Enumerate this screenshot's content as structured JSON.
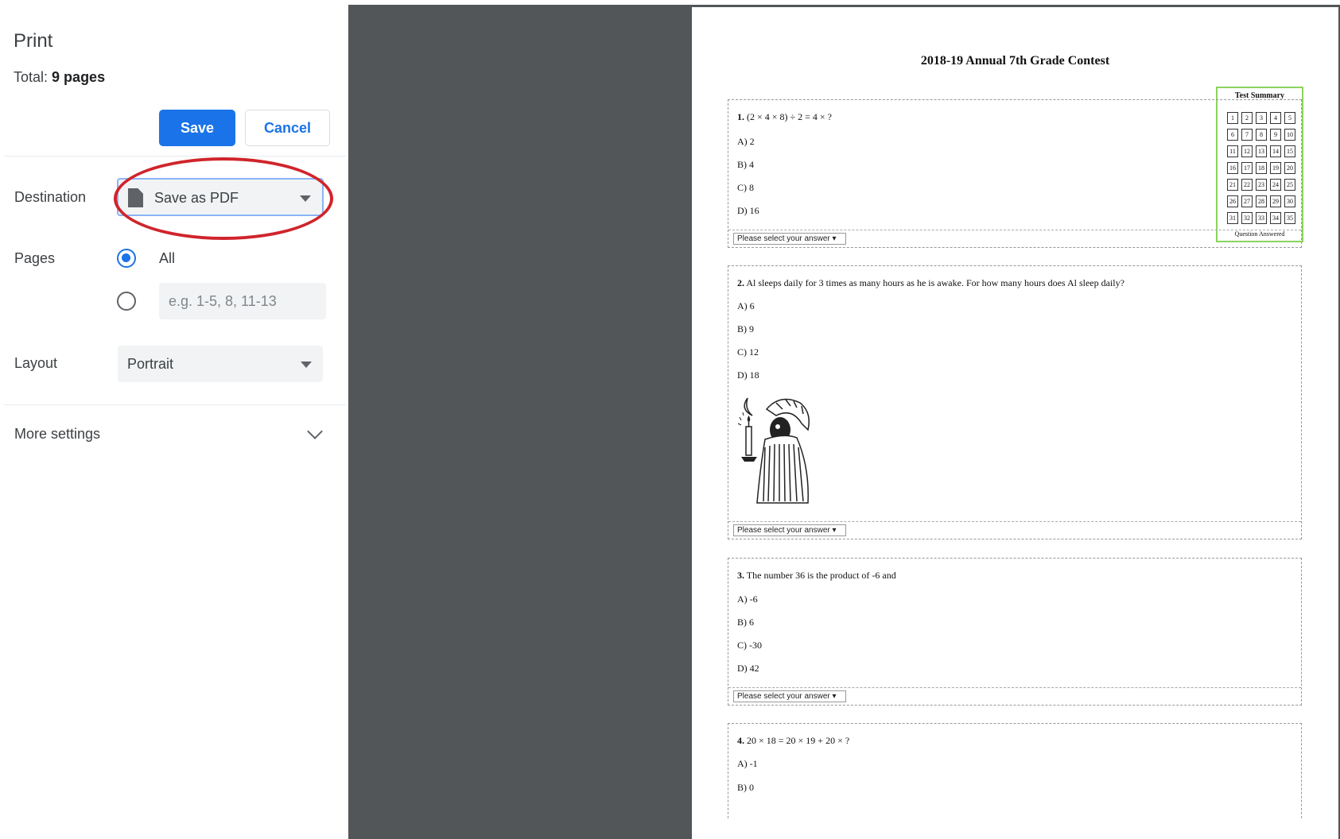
{
  "print_panel": {
    "title": "Print",
    "total_label": "Total:",
    "total_value": "9 pages",
    "save_label": "Save",
    "cancel_label": "Cancel",
    "destination_label": "Destination",
    "destination_value": "Save as PDF",
    "pages_label": "Pages",
    "pages_option_all": "All",
    "pages_custom_placeholder": "e.g. 1-5, 8, 11-13",
    "layout_label": "Layout",
    "layout_value": "Portrait",
    "more_settings_label": "More settings",
    "annotation_color": "#d0242b",
    "accent_color": "#1a73e8"
  },
  "preview": {
    "doc_title": "2018-19 Annual 7th Grade Contest",
    "answer_select_label": "Please select your answer",
    "summary": {
      "title": "Test Summary",
      "cells": [
        "1",
        "2",
        "3",
        "4",
        "5",
        "6",
        "7",
        "8",
        "9",
        "10",
        "11",
        "12",
        "13",
        "14",
        "15",
        "16",
        "17",
        "18",
        "19",
        "20",
        "21",
        "22",
        "23",
        "24",
        "25",
        "26",
        "27",
        "28",
        "29",
        "30",
        "31",
        "32",
        "33",
        "34",
        "35"
      ],
      "footer": "Question Answered"
    },
    "questions": [
      {
        "number": "1.",
        "text": "(2 × 4 × 8) ÷ 2 = 4 × ?",
        "options": [
          "A) 2",
          "B) 4",
          "C) 8",
          "D) 16"
        ]
      },
      {
        "number": "2.",
        "text": "Al sleeps daily for 3 times as many hours as he is awake. For how many hours does Al sleep daily?",
        "options": [
          "A) 6",
          "B) 9",
          "C) 12",
          "D) 18"
        ]
      },
      {
        "number": "3.",
        "text": "The number 36 is the product of -6 and",
        "options": [
          "A) -6",
          "B) 6",
          "C) -30",
          "D) 42"
        ]
      },
      {
        "number": "4.",
        "text": "20 × 18 = 20 × 19 + 20 × ?",
        "options": [
          "A) -1",
          "B) 0"
        ]
      }
    ]
  }
}
